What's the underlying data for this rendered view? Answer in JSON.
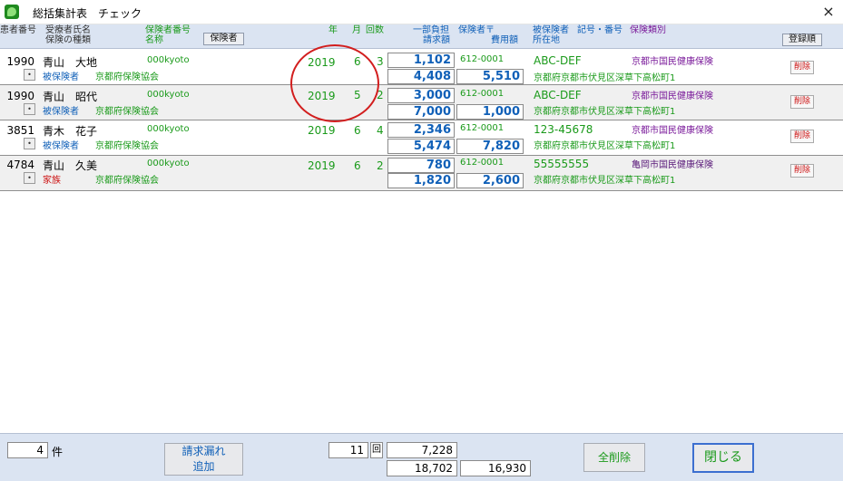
{
  "window": {
    "title": "総括集計表　チェック",
    "close_glyph": "×"
  },
  "header": {
    "patient_no": "患者番号",
    "recipient_name": "受療者氏名",
    "insurance_type": "保険の種類",
    "insurer_no": "保険者番号",
    "insurer_name": "名称",
    "insurer_btn": "保険者",
    "year": "年",
    "month": "月",
    "count": "回数",
    "partial": "一部負担",
    "claim": "請求額",
    "insurer_post": "保険者〒",
    "cost": "費用額",
    "insured": "被保険者",
    "symbol_no": "記号・番号",
    "address": "所在地",
    "insurance_class": "保険類別",
    "register_btn": "登録順"
  },
  "rows": [
    {
      "patient_no": "1990",
      "name": "青山　大地",
      "relation": "被保険者",
      "insurer": "京都府保険協会",
      "insurer_no": "000kyoto",
      "year": "2019",
      "month": "6",
      "count": "3",
      "partial": "1,102",
      "claim": "4,408",
      "post": "612-0001",
      "cost": "5,510",
      "symbol": "ABC-DEF",
      "address": "京都府京都市伏見区深草下高松町1",
      "class": "京都市国民健康保険",
      "del": "削除"
    },
    {
      "patient_no": "1990",
      "name": "青山　昭代",
      "relation": "被保険者",
      "insurer": "京都府保険協会",
      "insurer_no": "000kyoto",
      "year": "2019",
      "month": "5",
      "count": "2",
      "partial": "3,000",
      "claim": "7,000",
      "post": "612-0001",
      "cost": "1,000",
      "symbol": "ABC-DEF",
      "address": "京都府京都市伏見区深草下高松町1",
      "class": "京都市国民健康保険",
      "del": "削除"
    },
    {
      "patient_no": "3851",
      "name": "青木　花子",
      "relation": "被保険者",
      "insurer": "京都府保険協会",
      "insurer_no": "000kyoto",
      "year": "2019",
      "month": "6",
      "count": "4",
      "partial": "2,346",
      "claim": "5,474",
      "post": "612-0001",
      "cost": "7,820",
      "symbol": "123-45678",
      "address": "京都府京都市伏見区深草下高松町1",
      "class": "京都市国民健康保険",
      "del": "削除"
    },
    {
      "patient_no": "4784",
      "name": "青山　久美",
      "relation": "家族",
      "insurer": "京都府保険協会",
      "insurer_no": "000kyoto",
      "year": "2019",
      "month": "6",
      "count": "2",
      "partial": "780",
      "claim": "1,820",
      "post": "612-0001",
      "cost": "2,600",
      "symbol": "55555555",
      "address": "京都府京都市伏見区深草下高松町1",
      "class": "亀岡市国民健康保険",
      "del": "削除"
    }
  ],
  "row_button_glyph": "•",
  "footer": {
    "record_count": "4",
    "record_unit": "件",
    "add_missing_line1": "請求漏れ",
    "add_missing_line2": "追加",
    "total_visits": "11",
    "visits_unit": "回",
    "total_partial": "7,228",
    "total_claim": "18,702",
    "total_cost": "16,930",
    "delete_all": "全削除",
    "close": "閉じる"
  }
}
